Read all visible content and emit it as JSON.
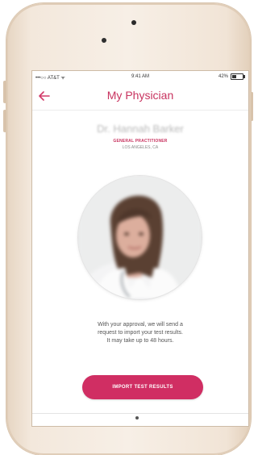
{
  "status_bar": {
    "carrier": "•••○○ AT&T ᯤ",
    "time": "9:41 AM",
    "battery": "42%",
    "battery_level": 0.42
  },
  "navbar": {
    "back_icon": "back-arrow-icon",
    "title": "My Physician"
  },
  "doctor": {
    "name": "Dr. Hannah Barker",
    "title": "GENERAL PRACTITIONER",
    "location": "LOS ANGELES, CA"
  },
  "message": {
    "lines": [
      "With your approval, we will send a",
      "request to import your test results.",
      "It may take up to 48 hours."
    ]
  },
  "import_button": {
    "label": "IMPORT TEST RESULTS"
  },
  "colors": {
    "accent": "#d02e63",
    "title": "#c8335f",
    "phone_body": "#f3e8dc"
  }
}
